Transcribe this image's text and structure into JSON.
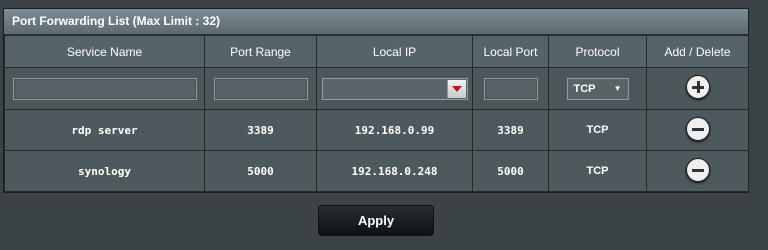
{
  "panel": {
    "title": "Port Forwarding List (Max Limit : 32)"
  },
  "columns": [
    "Service Name",
    "Port Range",
    "Local IP",
    "Local Port",
    "Protocol",
    "Add / Delete"
  ],
  "new_entry": {
    "service_name": "",
    "port_range": "",
    "local_ip": "",
    "local_port": "",
    "protocol": "TCP",
    "add_icon": "plus-circle-icon",
    "ip_dropdown_icon": "triangle-down-icon"
  },
  "rows": [
    {
      "service_name": "rdp server",
      "port_range": "3389",
      "local_ip": "192.168.0.99",
      "local_port": "3389",
      "protocol": "TCP",
      "delete_icon": "minus-circle-icon"
    },
    {
      "service_name": "synology",
      "port_range": "5000",
      "local_ip": "192.168.0.248",
      "local_port": "5000",
      "protocol": "TCP",
      "delete_icon": "minus-circle-icon"
    }
  ],
  "apply_label": "Apply",
  "colors": {
    "background": "#3c4347",
    "accent_red": "#c0141b",
    "header": "#566469"
  }
}
